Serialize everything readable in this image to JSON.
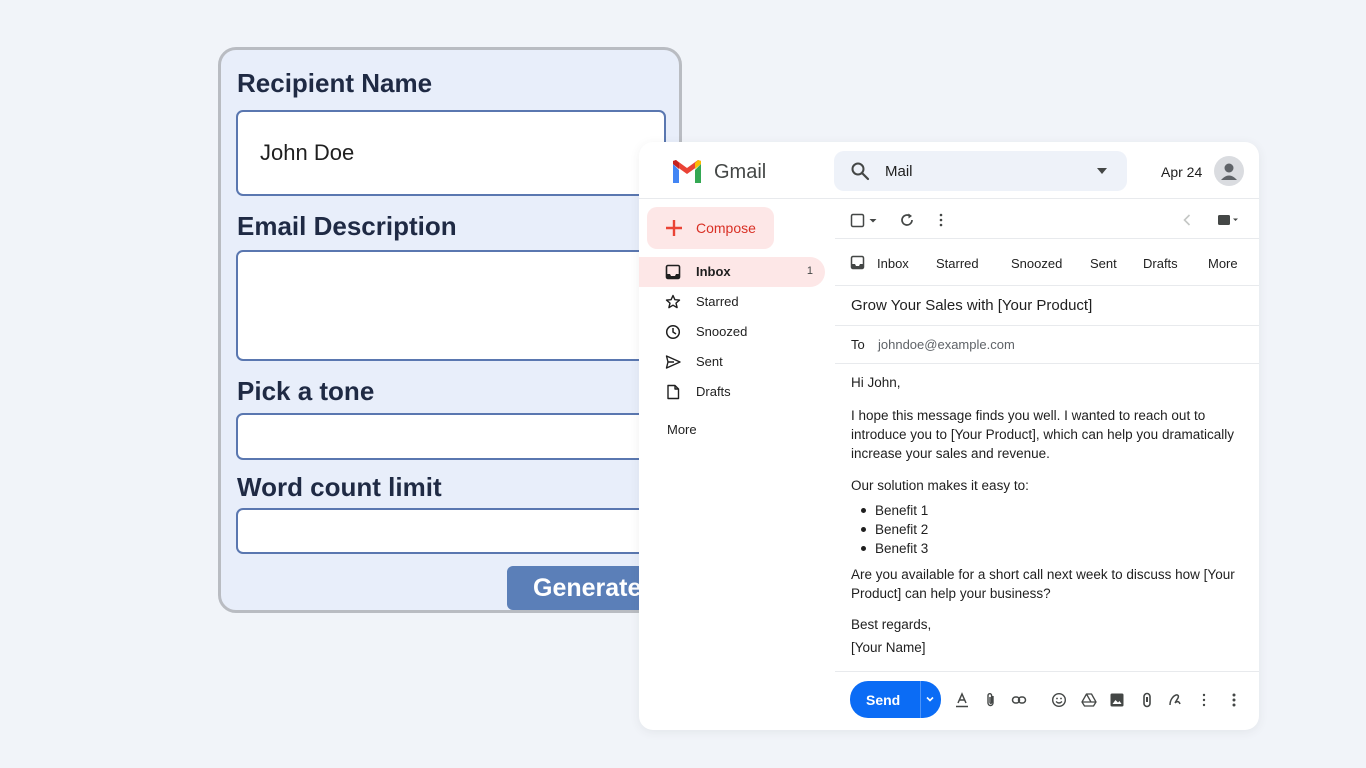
{
  "form": {
    "recipient_label": "Recipient Name",
    "recipient_value": "John Doe",
    "description_label": "Email Description",
    "description_value": "",
    "tone_label": "Pick a tone",
    "tone_value": "",
    "word_limit_label": "Word count limit",
    "word_limit_value": "",
    "generate_label": "Generate"
  },
  "gmail": {
    "title": "Gmail",
    "search_placeholder": "Mail",
    "date": "Apr 24",
    "compose_label": "Compose",
    "nav": [
      {
        "label": "Inbox",
        "count": "1",
        "icon": "inbox-icon",
        "active": true
      },
      {
        "label": "Starred",
        "count": "",
        "icon": "star-icon"
      },
      {
        "label": "Snoozed",
        "count": "",
        "icon": "clock-icon"
      },
      {
        "label": "Sent",
        "count": "",
        "icon": "send-icon"
      },
      {
        "label": "Drafts",
        "count": "",
        "icon": "draft-icon"
      }
    ],
    "nav_more": "More",
    "tabs": [
      "Inbox",
      "Starred",
      "Snoozed",
      "Sent",
      "Drafts",
      "More"
    ],
    "email": {
      "subject": "Grow Your Sales with [Your Product]",
      "to_label": "To",
      "to_value": "johndoe@example.com",
      "greeting": "Hi John,",
      "para1": "I hope this message finds you well. I wanted to reach out to introduce you to [Your Product], which can help you dramatically increase your sales and revenue.",
      "para2": "Our solution makes it easy to:",
      "benefits": [
        "Benefit 1",
        "Benefit 2",
        "Benefit 3"
      ],
      "para3": "Are you available for a short call next week to discuss how [Your Product] can help your business?",
      "closing": "Best regards,",
      "signature": "[Your Name]"
    },
    "send_label": "Send",
    "colors": {
      "accent": "#0b6cf5",
      "compose_bg": "#fde7e7",
      "compose_text": "#d93025"
    }
  }
}
